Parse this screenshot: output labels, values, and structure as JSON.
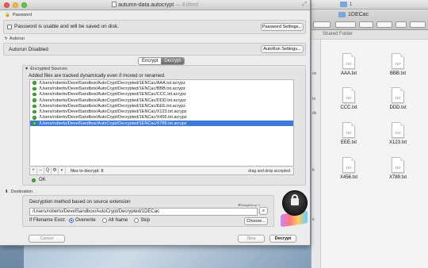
{
  "window": {
    "title": "autumn-data.autocrypt",
    "edited_label": "— Edited"
  },
  "password": {
    "section_label": "Password",
    "status_text": "Password is usable and will be saved on disk.",
    "settings_button": "Password Settings..."
  },
  "autorun": {
    "section_label": "Autorun",
    "status_text": "Autorun Disabled",
    "settings_button": "AutoRun Settings..."
  },
  "mode_tabs": {
    "encrypt": "Encrypt",
    "decrypt": "Decrypt",
    "selected": "Decrypt"
  },
  "sources": {
    "section_label": "Encrypted Sources",
    "description": "Added files are tracked dynamically even if moved or renamed.",
    "files": [
      "/Users/roberto/DevelSandbox/AutoCrypt/Decrypted/1ENCac/AAA.txt.acrypz",
      "/Users/roberto/DevelSandbox/AutoCrypt/Decrypted/1ENCac/BBB.txt.acrypz",
      "/Users/roberto/DevelSandbox/AutoCrypt/Decrypted/1ENCac/CCC.txt.acrypz",
      "/Users/roberto/DevelSandbox/AutoCrypt/Decrypted/1ENCac/DDD.txt.acrypz",
      "/Users/roberto/DevelSandbox/AutoCrypt/Decrypted/1ENCac/EEE.txt.acrypz",
      "/Users/roberto/DevelSandbox/AutoCrypt/Decrypted/1ENCac/X123.txt.acrypz",
      "/Users/roberto/DevelSandbox/AutoCrypt/Decrypted/1ENCac/X456.txt.acrypz",
      "/Users/roberto/DevelSandbox/AutoCrypt/Decrypted/1ENCac/X789.txt.acrypz"
    ],
    "selected_index": 7,
    "add_label": "+",
    "remove_label": "–",
    "search_label": "Q",
    "gear_label": "⚙",
    "count_text": "files to decrypt: 8",
    "hint_text": "drag and drop accepted",
    "status_text": "OK"
  },
  "destination": {
    "section_label": "Destination",
    "description": "Decryption method based on source extension",
    "path_value": "/Users/roberto/DevelSandbox/AutoCrypt/Decrypted/1DECac",
    "path_hint": "⌘Drag&Drop⌥",
    "choose_button": "Choose...",
    "exists_label": "If Filename Exist:",
    "options": [
      "Overwrite",
      "Alt Name",
      "Skip"
    ],
    "selected_option": "Overwrite"
  },
  "buttons": {
    "cancel": "Cancel",
    "stop": "Stop",
    "decrypt": "Decrypt"
  },
  "finder": {
    "title": "1",
    "path": "1DECac",
    "header": "Shared Folder",
    "side_labels": [
      "os",
      "rs",
      "ds",
      "h",
      "s"
    ],
    "files": [
      "AAA.txt",
      "BBB.txt",
      "CCC.txt",
      "DDD.txt",
      "EEE.txt",
      "X123.txt",
      "X456.txt",
      "X789.txt"
    ],
    "file_badge": "TXT"
  }
}
